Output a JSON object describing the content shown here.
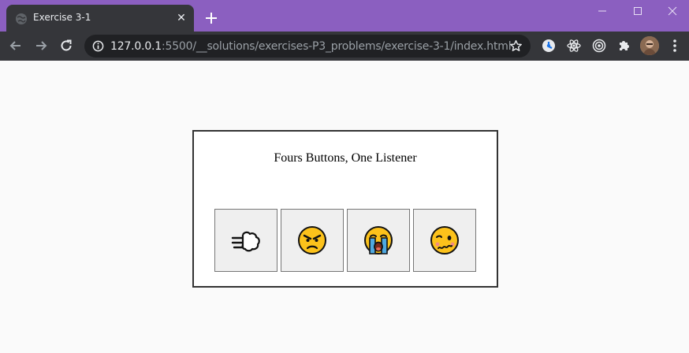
{
  "browser": {
    "tab_title": "Exercise 3-1",
    "tab_close_glyph": "✕",
    "url_host": "127.0.0.1",
    "url_rest": ":5500/__solutions/exercises-P3_problems/exercise-3-1/index.html",
    "accent_color": "#8b5fc0",
    "icons": [
      "globe-icon",
      "close-icon",
      "new-tab-icon",
      "minimize-icon",
      "maximize-icon",
      "window-close-icon",
      "back-icon",
      "forward-icon",
      "reload-icon",
      "info-icon",
      "star-icon",
      "extension-icon",
      "react-devtools-icon",
      "target-icon",
      "puzzle-icon",
      "avatar",
      "menu-icon"
    ]
  },
  "page": {
    "title": "Fours Buttons, One Listener",
    "buttons": [
      {
        "name": "wind-face-button",
        "emoji": "dashing-away"
      },
      {
        "name": "angry-face-button",
        "emoji": "angry-face"
      },
      {
        "name": "crying-face-button",
        "emoji": "loudly-crying-face"
      },
      {
        "name": "woozy-face-button",
        "emoji": "woozy-face"
      }
    ]
  }
}
